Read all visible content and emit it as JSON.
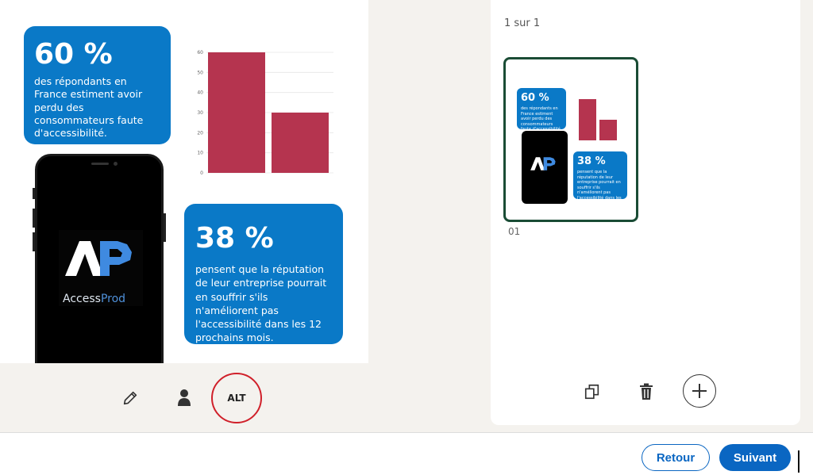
{
  "slide": {
    "card1": {
      "percent": "60 %",
      "desc": "des répondants en France estiment avoir perdu des consommateurs faute d'accessibilité."
    },
    "card2": {
      "percent": "38 %",
      "desc": "pensent que la réputation de leur entreprise pourrait en souffrir s'ils n'améliorent pas l'accessibilité dans les 12 prochains mois."
    },
    "logo": {
      "mark": "AP",
      "text_a": "Access",
      "text_b": "Prod"
    }
  },
  "chart_data": {
    "type": "bar",
    "categories": [
      "",
      ""
    ],
    "values": [
      60,
      30
    ],
    "ylim": [
      0,
      60
    ],
    "yticks": [
      0,
      10,
      20,
      30,
      40,
      50,
      60
    ],
    "color": "#b5344f",
    "grid": true
  },
  "toolbar": {
    "alt_label": "ALT",
    "icons": [
      "pencil-icon",
      "person-icon"
    ]
  },
  "panel": {
    "page_count": "1 sur 1",
    "thumb_label": "01",
    "thumb_card1_percent": "60 %",
    "thumb_card1_desc": "des répondants en France estiment avoir perdu des consommateurs faute d'accessibilité.",
    "thumb_card2_percent": "38 %",
    "thumb_card2_desc": "pensent que la réputation de leur entreprise pourrait en souffrir s'ils n'améliorent pas l'accessibilité dans les 12 prochains mois."
  },
  "footer": {
    "back_label": "Retour",
    "next_label": "Suivant"
  }
}
